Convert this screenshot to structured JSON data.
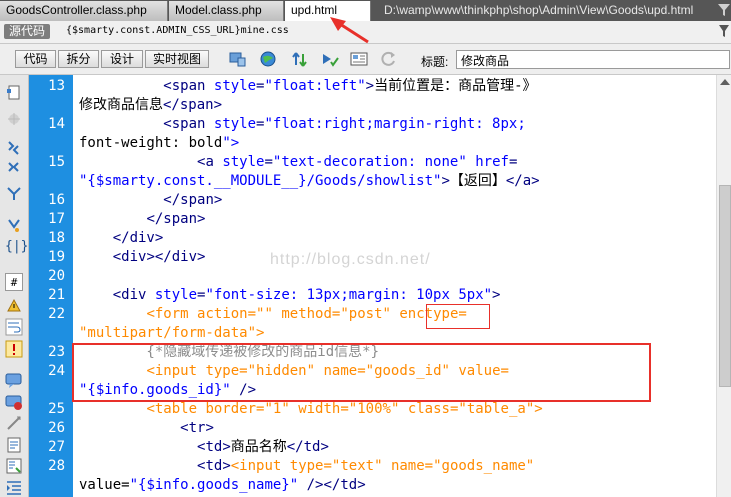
{
  "tabs": [
    {
      "label": "GoodsController.class.php",
      "active": false
    },
    {
      "label": "Model.class.php",
      "active": false
    },
    {
      "label": "upd.html",
      "active": true
    }
  ],
  "tab_path": "D:\\wamp\\www\\thinkphp\\shop\\Admin\\View\\Goods\\upd.html",
  "related_files": {
    "source_label": "源代码",
    "css_file": "{$smarty.const.ADMIN_CSS_URL}mine.css"
  },
  "toolbar": {
    "views": [
      "代码",
      "拆分",
      "设计",
      "实时视图"
    ],
    "title_label": "标题:",
    "title_value": "修改商品"
  },
  "icons": {
    "tab_filter": "filter-icon",
    "toolbar": [
      "multiscreen-icon",
      "preview-in-browser-icon",
      "file-management-icon",
      "check-page-icon",
      "visual-aids-icon",
      "refresh-icon"
    ],
    "coding": [
      "open-documents-icon",
      "collapse-full-tag-icon",
      "collapse-selection-icon",
      "expand-all-icon",
      "select-parent-tag-icon",
      "balance-braces-icon",
      "line-numbers-icon",
      "highlight-invalid-code-icon",
      "word-wrap-icon",
      "syntax-error-alerts-icon",
      "apply-comment-icon",
      "remove-comment-icon",
      "wrap-tag-icon",
      "recent-snippets-icon",
      "move-css-icon",
      "indent-code-icon"
    ]
  },
  "code_lines": [
    {
      "num": "13",
      "text": "          <span style=\"float:left\">当前位置是：商品管理-》"
    },
    {
      "num": "",
      "text": "修改商品信息</span>"
    },
    {
      "num": "14",
      "text": "          <span style=\"float:right;margin-right: 8px;"
    },
    {
      "num": "",
      "text": "font-weight: bold\">"
    },
    {
      "num": "15",
      "text": "              <a style=\"text-decoration: none\" href="
    },
    {
      "num": "",
      "text": "\"{$smarty.const.__MODULE__}/Goods/showlist\">【返回】</a>"
    },
    {
      "num": "16",
      "text": "          </span>"
    },
    {
      "num": "17",
      "text": "        </span>"
    },
    {
      "num": "18",
      "text": "    </div>"
    },
    {
      "num": "19",
      "text": "    <div></div>"
    },
    {
      "num": "20",
      "text": ""
    },
    {
      "num": "21",
      "text": "    <div style=\"font-size: 13px;margin: 10px 5px\">"
    },
    {
      "num": "22",
      "text": "        <form action=\"\" method=\"post\" enctype="
    },
    {
      "num": "",
      "text": "\"multipart/form-data\">"
    },
    {
      "num": "23",
      "text": "        {*隐藏域传递被修改的商品id信息*}"
    },
    {
      "num": "24",
      "text": "        <input type=\"hidden\" name=\"goods_id\" value="
    },
    {
      "num": "",
      "text": "\"{$info.goods_id}\" />"
    },
    {
      "num": "25",
      "text": "        <table border=\"1\" width=\"100%\" class=\"table_a\">"
    },
    {
      "num": "26",
      "text": "            <tr>"
    },
    {
      "num": "27",
      "text": "              <td>商品名称</td>"
    },
    {
      "num": "28",
      "text": "              <td><input type=\"text\" name=\"goods_name\""
    },
    {
      "num": "",
      "text": "value=\"{$info.goods_name}\" /></td>"
    }
  ],
  "watermark": "http://blog.csdn.net/",
  "colors": {
    "tag": "#000080",
    "attribute": "#0000ff",
    "form_tag": "#ff8a00",
    "comment": "#8c8c8c",
    "gutter": "#1e8fe1",
    "annotation": "#e8302a"
  }
}
